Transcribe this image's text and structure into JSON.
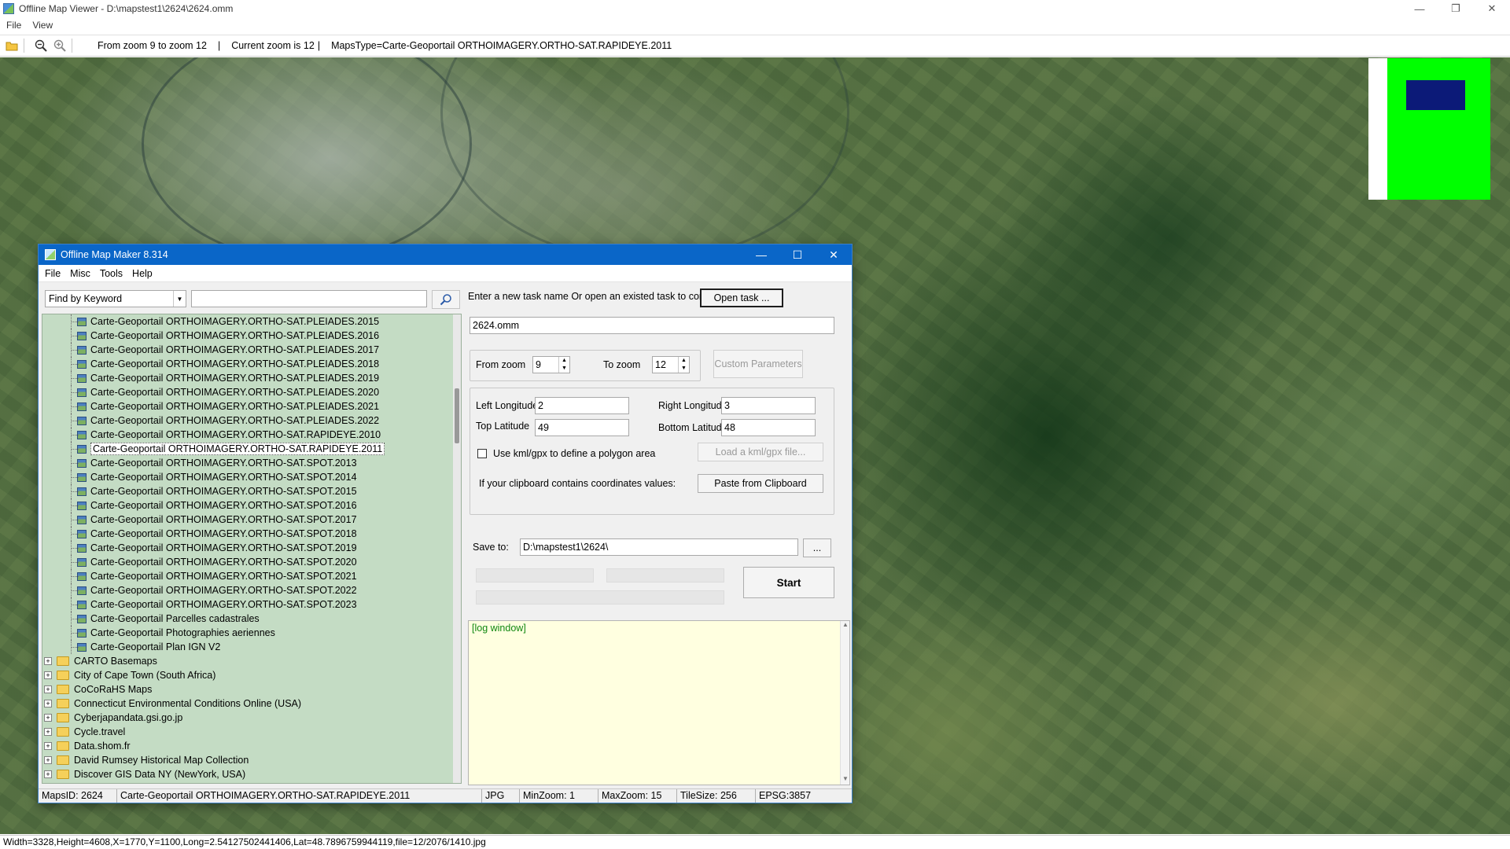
{
  "viewer": {
    "title": "Offline Map Viewer - D:\\mapstest1\\2624\\2624.omm",
    "menu": [
      "File",
      "View"
    ],
    "toolbar": {
      "zoom_range": "From zoom 9 to zoom 12",
      "current_zoom": "Current zoom is 12",
      "sep1": "|",
      "sep2": "|",
      "maps_type": "MapsType=Carte-Geoportail ORTHOIMAGERY.ORTHO-SAT.RAPIDEYE.2011"
    },
    "window_controls": {
      "minimize": "—",
      "maximize": "❐",
      "close": "✕"
    },
    "status": "Width=3328,Height=4608,X=1770,Y=1100,Long=2.54127502441406,Lat=48.7896759944119,file=12/2076/1410.jpg",
    "minimap_colors": {
      "background": "#00ff00",
      "viewport": "#0c1a78"
    }
  },
  "maker": {
    "title": "Offline Map Maker 8.314",
    "menu": [
      "File",
      "Misc",
      "Tools",
      "Help"
    ],
    "window_controls": {
      "minimize": "—",
      "maximize": "☐",
      "close": "✕"
    },
    "search": {
      "mode": "Find by Keyword",
      "query": ""
    },
    "tree": {
      "leaves": [
        "Carte-Geoportail ORTHOIMAGERY.ORTHO-SAT.PLEIADES.2015",
        "Carte-Geoportail ORTHOIMAGERY.ORTHO-SAT.PLEIADES.2016",
        "Carte-Geoportail ORTHOIMAGERY.ORTHO-SAT.PLEIADES.2017",
        "Carte-Geoportail ORTHOIMAGERY.ORTHO-SAT.PLEIADES.2018",
        "Carte-Geoportail ORTHOIMAGERY.ORTHO-SAT.PLEIADES.2019",
        "Carte-Geoportail ORTHOIMAGERY.ORTHO-SAT.PLEIADES.2020",
        "Carte-Geoportail ORTHOIMAGERY.ORTHO-SAT.PLEIADES.2021",
        "Carte-Geoportail ORTHOIMAGERY.ORTHO-SAT.PLEIADES.2022",
        "Carte-Geoportail ORTHOIMAGERY.ORTHO-SAT.RAPIDEYE.2010",
        "Carte-Geoportail ORTHOIMAGERY.ORTHO-SAT.RAPIDEYE.2011",
        "Carte-Geoportail ORTHOIMAGERY.ORTHO-SAT.SPOT.2013",
        "Carte-Geoportail ORTHOIMAGERY.ORTHO-SAT.SPOT.2014",
        "Carte-Geoportail ORTHOIMAGERY.ORTHO-SAT.SPOT.2015",
        "Carte-Geoportail ORTHOIMAGERY.ORTHO-SAT.SPOT.2016",
        "Carte-Geoportail ORTHOIMAGERY.ORTHO-SAT.SPOT.2017",
        "Carte-Geoportail ORTHOIMAGERY.ORTHO-SAT.SPOT.2018",
        "Carte-Geoportail ORTHOIMAGERY.ORTHO-SAT.SPOT.2019",
        "Carte-Geoportail ORTHOIMAGERY.ORTHO-SAT.SPOT.2020",
        "Carte-Geoportail ORTHOIMAGERY.ORTHO-SAT.SPOT.2021",
        "Carte-Geoportail ORTHOIMAGERY.ORTHO-SAT.SPOT.2022",
        "Carte-Geoportail ORTHOIMAGERY.ORTHO-SAT.SPOT.2023",
        "Carte-Geoportail Parcelles cadastrales",
        "Carte-Geoportail Photographies aeriennes",
        "Carte-Geoportail Plan IGN V2"
      ],
      "selected_leaf": "Carte-Geoportail ORTHOIMAGERY.ORTHO-SAT.RAPIDEYE.2011",
      "folders": [
        "CARTO Basemaps",
        "City of Cape Town (South Africa)",
        "CoCoRaHS Maps",
        "Connecticut Environmental Conditions Online (USA)",
        "Cyberjapandata.gsi.go.jp",
        "Cycle.travel",
        "Data.shom.fr",
        "David Rumsey Historical Map Collection",
        "Discover GIS Data NY (NewYork, USA)"
      ],
      "expander_symbol": "+"
    },
    "task": {
      "prompt": "Enter a new task name Or open an existed task to continue:",
      "open_button": "Open task ...",
      "name_value": "2624.omm"
    },
    "zoom": {
      "from_label": "From zoom",
      "from_value": "9",
      "to_label": "To zoom",
      "to_value": "12",
      "custom_button": "Custom Parameters"
    },
    "bounds": {
      "left_lon_label": "Left Longitude",
      "left_lon": "2",
      "right_lon_label": "Right Longitude",
      "right_lon": "3",
      "top_lat_label": "Top Latitude",
      "top_lat": "49",
      "bottom_lat_label": "Bottom Latitude",
      "bottom_lat": "48",
      "kml_checkbox_label": "Use kml/gpx to define a polygon area",
      "kml_checked": false,
      "load_kml_button": "Load a kml/gpx file...",
      "clipboard_label": "If your clipboard contains coordinates values:",
      "paste_button": "Paste from Clipboard"
    },
    "save": {
      "label": "Save to:",
      "path": "D:\\mapstest1\\2624\\",
      "browse_button": "...",
      "start_button": "Start"
    },
    "log_text": "[log window]",
    "status": {
      "maps_id": "MapsID: 2624",
      "map_name": "Carte-Geoportail ORTHOIMAGERY.ORTHO-SAT.RAPIDEYE.2011",
      "format": "JPG",
      "min_zoom": "MinZoom: 1",
      "max_zoom": "MaxZoom: 15",
      "tile_size": "TileSize: 256",
      "epsg": "EPSG:3857"
    }
  }
}
